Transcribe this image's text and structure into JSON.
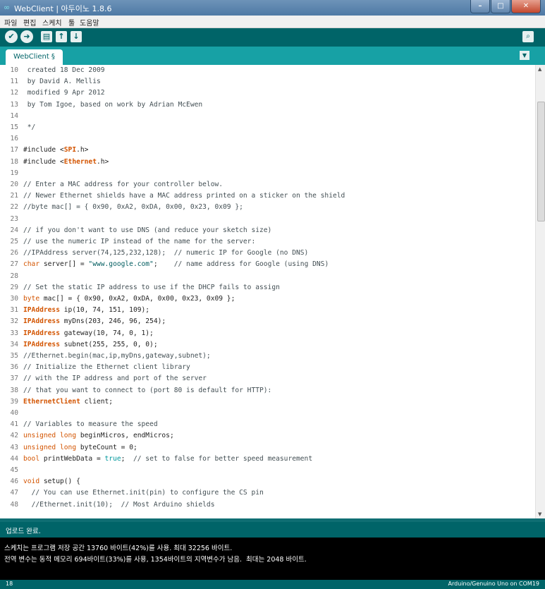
{
  "window": {
    "app_icon": "infinity-icon",
    "title": "WebClient | 아두이노 1.8.6",
    "buttons": {
      "minimize": "–",
      "maximize": "□",
      "close": "✕"
    }
  },
  "menu": [
    "파일",
    "편집",
    "스케치",
    "툴",
    "도움말"
  ],
  "toolbar": {
    "verify_icon": "check-icon",
    "upload_icon": "arrow-right-icon",
    "new_icon": "new-file-icon",
    "open_icon": "arrow-up-icon",
    "save_icon": "arrow-down-icon",
    "serial_monitor_icon": "magnifier-icon"
  },
  "tabs": [
    {
      "label": "WebClient §"
    }
  ],
  "tab_menu_icon": "chevron-down-icon",
  "editor": {
    "lines": [
      {
        "n": "10",
        "text": " created 18 Dec 2009"
      },
      {
        "n": "11",
        "text": " by David A. Mellis"
      },
      {
        "n": "12",
        "text": " modified 9 Apr 2012"
      },
      {
        "n": "13",
        "text": " by Tom Igoe, based on work by Adrian McEwen"
      },
      {
        "n": "14",
        "text": ""
      },
      {
        "n": "15",
        "text": " */"
      },
      {
        "n": "16",
        "text": ""
      },
      {
        "n": "17",
        "text": "#include <SPI.h>"
      },
      {
        "n": "18",
        "text": "#include <Ethernet.h>"
      },
      {
        "n": "19",
        "text": ""
      },
      {
        "n": "20",
        "text": "// Enter a MAC address for your controller below."
      },
      {
        "n": "21",
        "text": "// Newer Ethernet shields have a MAC address printed on a sticker on the shield"
      },
      {
        "n": "22",
        "text": "//byte mac[] = { 0x90, 0xA2, 0xDA, 0x00, 0x23, 0x09 };"
      },
      {
        "n": "23",
        "text": ""
      },
      {
        "n": "24",
        "text": "// if you don't want to use DNS (and reduce your sketch size)"
      },
      {
        "n": "25",
        "text": "// use the numeric IP instead of the name for the server:"
      },
      {
        "n": "26",
        "text": "//IPAddress server(74,125,232,128);  // numeric IP for Google (no DNS)"
      },
      {
        "n": "27",
        "text": "char server[] = \"www.google.com\";    // name address for Google (using DNS)"
      },
      {
        "n": "28",
        "text": ""
      },
      {
        "n": "29",
        "text": "// Set the static IP address to use if the DHCP fails to assign"
      },
      {
        "n": "30",
        "text": "byte mac[] = { 0x90, 0xA2, 0xDA, 0x00, 0x23, 0x09 };"
      },
      {
        "n": "31",
        "text": "IPAddress ip(10, 74, 151, 109);"
      },
      {
        "n": "32",
        "text": "IPAddress myDns(203, 246, 96, 254);"
      },
      {
        "n": "33",
        "text": "IPAddress gateway(10, 74, 0, 1);"
      },
      {
        "n": "34",
        "text": "IPAddress subnet(255, 255, 0, 0);"
      },
      {
        "n": "35",
        "text": "//Ethernet.begin(mac,ip,myDns,gateway,subnet);"
      },
      {
        "n": "36",
        "text": "// Initialize the Ethernet client library"
      },
      {
        "n": "37",
        "text": "// with the IP address and port of the server"
      },
      {
        "n": "38",
        "text": "// that you want to connect to (port 80 is default for HTTP):"
      },
      {
        "n": "39",
        "text": "EthernetClient client;"
      },
      {
        "n": "40",
        "text": ""
      },
      {
        "n": "41",
        "text": "// Variables to measure the speed"
      },
      {
        "n": "42",
        "text": "unsigned long beginMicros, endMicros;"
      },
      {
        "n": "43",
        "text": "unsigned long byteCount = 0;"
      },
      {
        "n": "44",
        "text": "bool printWebData = true;  // set to false for better speed measurement"
      },
      {
        "n": "45",
        "text": ""
      },
      {
        "n": "46",
        "text": "void setup() {"
      },
      {
        "n": "47",
        "text": "  // You can use Ethernet.init(pin) to configure the CS pin"
      },
      {
        "n": "48",
        "text": "  //Ethernet.init(10);  // Most Arduino shields"
      }
    ]
  },
  "status": {
    "message": "업로드 완료."
  },
  "console": {
    "lines": [
      "스케치는 프로그램 저장 공간 13760 바이트(42%)를 사용. 최대 32256 바이트.",
      "전역 변수는 동적 메모리 694바이트(33%)를 사용, 1354바이트의 지역변수가 남음.  최대는 2048 바이트."
    ]
  },
  "footer": {
    "line_number": "18",
    "board": "Arduino/Genuino Uno on COM19"
  }
}
